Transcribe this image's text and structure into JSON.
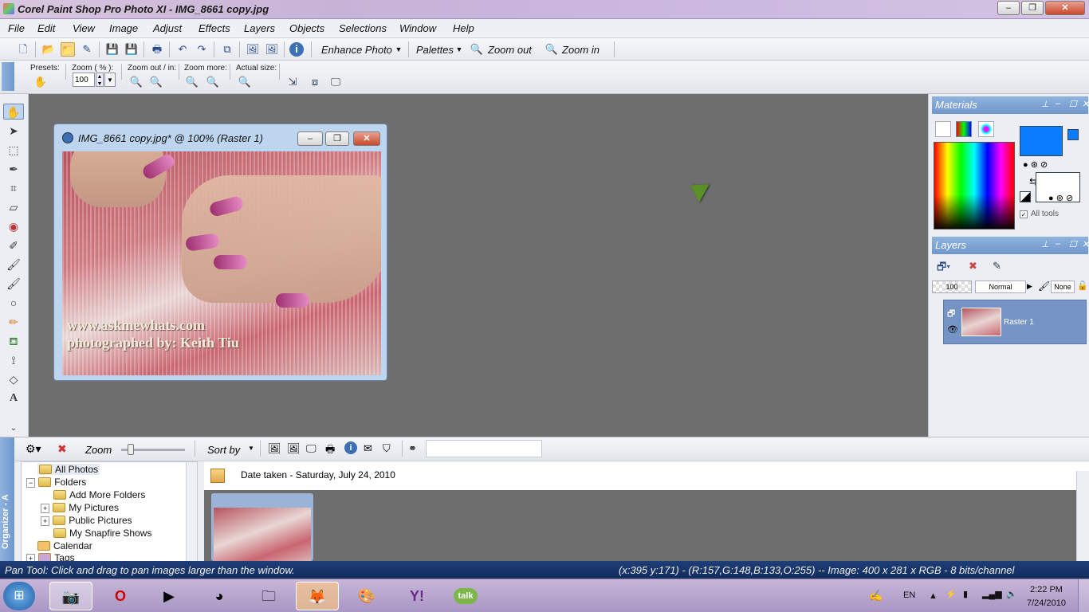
{
  "window": {
    "title": "Corel Paint Shop Pro Photo XI - IMG_8661 copy.jpg",
    "controls": {
      "minimize": "–",
      "restore": "❐",
      "close": "✕"
    }
  },
  "menubar": [
    "File",
    "Edit",
    "View",
    "Image",
    "Adjust",
    "Effects",
    "Layers",
    "Objects",
    "Selections",
    "Window",
    "Help"
  ],
  "toolbar": {
    "enhance_photo": "Enhance Photo",
    "palettes": "Palettes",
    "zoom_out": "Zoom out",
    "zoom_in": "Zoom in"
  },
  "tool_options": {
    "presets_label": "Presets:",
    "zoom_label": "Zoom ( % ):",
    "zoom_value": "100",
    "zoom_out_in_label": "Zoom out / in:",
    "zoom_more_label": "Zoom more:",
    "actual_size_label": "Actual size:"
  },
  "image_window": {
    "title": "IMG_8661 copy.jpg* @ 100% (Raster 1)",
    "watermark_line1": "www.askmewhats.com",
    "watermark_line2": "photographed by: Keith Tiu"
  },
  "materials": {
    "title": "Materials",
    "foreground_color": "#0a7cff",
    "background_color": "#ffffff",
    "all_tools_label": "All tools"
  },
  "layers": {
    "title": "Layers",
    "opacity": "100",
    "blend_mode": "Normal",
    "lock": "None",
    "layer_name": "Raster 1"
  },
  "organizer": {
    "side_label": "Organizer - A",
    "zoom_label": "Zoom",
    "sort_by_label": "Sort by",
    "date_header": "Date taken  -  Saturday, July 24, 2010",
    "tree": [
      "All Photos",
      "Folders",
      "Add More Folders",
      "My Pictures",
      "Public Pictures",
      "My Snapfire Shows",
      "Calendar",
      "Tags"
    ]
  },
  "statusbar": {
    "hint": "Pan Tool: Click and drag to pan images larger than the window.",
    "info": "(x:395 y:171) - (R:157,G:148,B:133,O:255) -- Image:  400 x 281 x RGB - 8 bits/channel"
  },
  "taskbar": {
    "language": "EN",
    "time": "2:22 PM",
    "date": "7/24/2010",
    "talk_label": "talk"
  }
}
